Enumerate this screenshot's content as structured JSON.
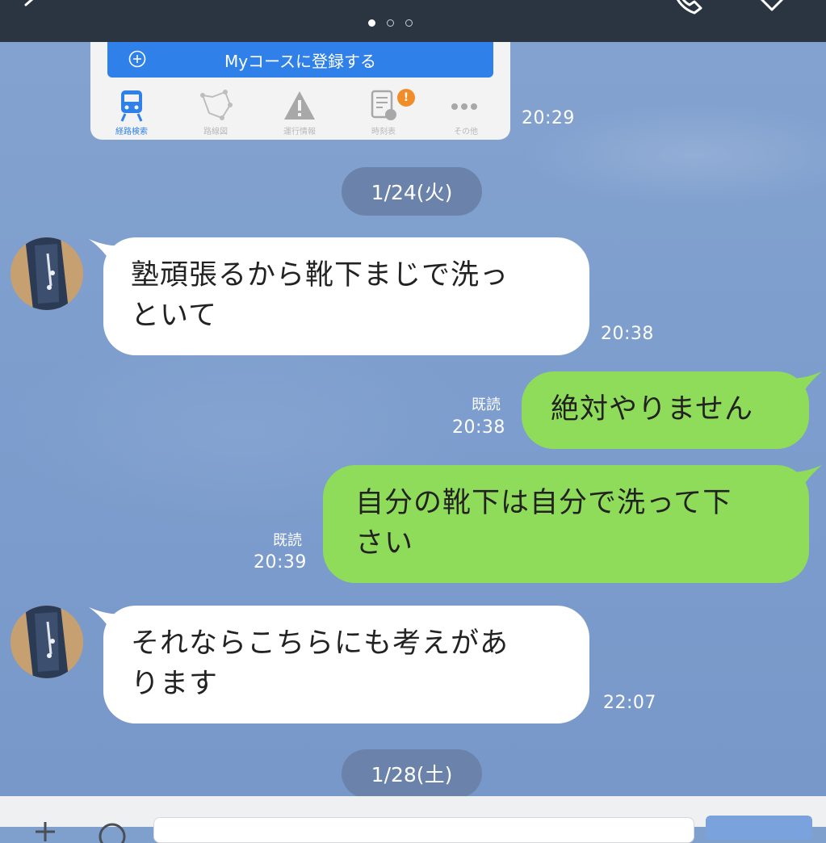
{
  "header": {
    "page_dots": 3,
    "active_dot": 0
  },
  "card": {
    "register_label": "Myコースに登録する",
    "tabs": [
      {
        "label": "経路検索",
        "icon": "train-icon",
        "active": true
      },
      {
        "label": "路線図",
        "icon": "route-map-icon",
        "active": false
      },
      {
        "label": "運行情報",
        "icon": "warning-icon",
        "active": false
      },
      {
        "label": "時刻表",
        "icon": "timetable-icon",
        "active": false
      },
      {
        "label": "その他",
        "icon": "more-icon",
        "active": false
      }
    ],
    "badge": "!",
    "time": "20:29"
  },
  "chat": {
    "date1": "1/24(火)",
    "msg1": {
      "line1": "塾頑張るから靴下まじで洗っ",
      "line2": "といて",
      "time": "20:38"
    },
    "msg2": {
      "text": "絶対やりません",
      "read": "既読",
      "time": "20:38"
    },
    "msg3": {
      "line1": "自分の靴下は自分で洗って下",
      "line2": "さい",
      "read": "既読",
      "time": "20:39"
    },
    "msg4": {
      "line1": "それならこちらにも考えがあ",
      "line2": "ります",
      "time": "22:07"
    },
    "date2": "1/28(土)"
  },
  "colors": {
    "background": "#7f9fcd",
    "header": "#2b3542",
    "outgoing_bubble": "#8fdc5a",
    "incoming_bubble": "#ffffff",
    "date_pill": "#6b83aa",
    "accent_blue": "#2f80e8"
  }
}
